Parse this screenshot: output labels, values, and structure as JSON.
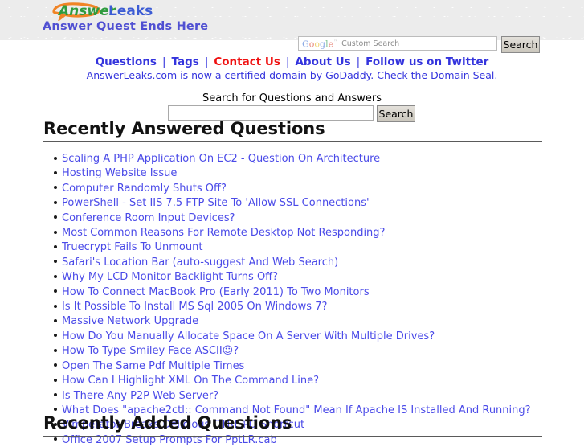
{
  "header": {
    "logo": {
      "icon": "answerleaks-logo",
      "text_primary": "Answer",
      "text_secondary": "Leaks",
      "color_primary": "#2e9b3e",
      "color_secondary": "#3b5bd4",
      "color_swoosh": "#f08426"
    },
    "tagline": "Answer Quest Ends Here"
  },
  "gcse": {
    "brand": "Google",
    "trademark": "™",
    "placeholder": "Custom Search",
    "value": "",
    "search_label": "Search"
  },
  "nav": {
    "separator": "|",
    "items": [
      {
        "label": "Questions",
        "accent": false
      },
      {
        "label": "Tags",
        "accent": false
      },
      {
        "label": "Contact Us",
        "accent": true
      },
      {
        "label": "About Us",
        "accent": false
      },
      {
        "label": "Follow us on Twitter",
        "accent": false
      }
    ]
  },
  "notice": "AnswerLeaks.com is now a certified domain by GoDaddy. Check the Domain Seal.",
  "site_search": {
    "label": "Search for Questions and Answers",
    "value": "",
    "placeholder": "",
    "button_label": "Search"
  },
  "sections": [
    {
      "title": "Recently Answered Questions",
      "questions": [
        "Scaling A PHP Application On EC2 - Question On Architecture",
        "Hosting Website Issue",
        "Computer Randomly Shuts Off?",
        "PowerShell - Set IIS 7.5 FTP Site To 'Allow SSL Connections'",
        "Conference Room Input Devices?",
        "Most Common Reasons For Remote Desktop Not Responding?",
        "Truecrypt Fails To Unmount",
        "Safari's Location Bar (auto-suggest And Web Search)",
        "Why My LCD Monitor Backlight Turns Off?",
        "How To Connect MacBook Pro (Early 2011) To Two Monitors",
        "Is It Possible To Install MS Sql 2005 On Windows 7?",
        "Massive Network Upgrade",
        "How Do You Manually Allocate Space On A Server With Multiple Drives?",
        "How To Type Smiley Face ASCII☺?",
        "Open The Same Pdf Multiple Times",
        "How Can I Highlight XML On The Command Line?",
        "Is There Any P2P Web Server?",
        "What Does \"apache2ctl:: Command Not Found\" Mean If Apache IS Installed And Running?",
        "Vimperator Breaks Delicious CTRL+D Shortcut",
        "Office 2007 Setup Prompts For PptLR.cab"
      ]
    },
    {
      "title": "Recently Added Questions",
      "questions": []
    }
  ]
}
